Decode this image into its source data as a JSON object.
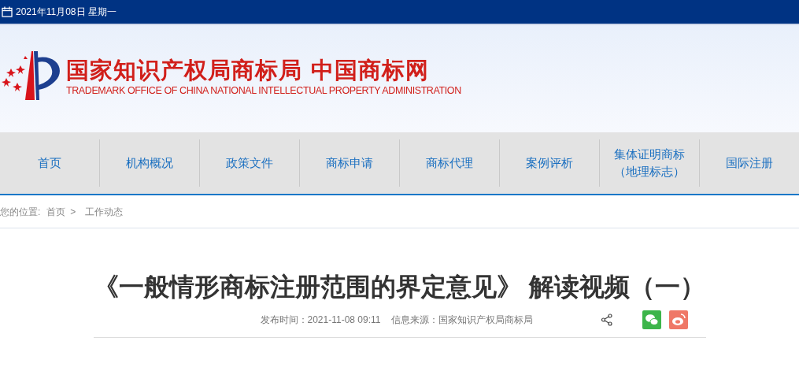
{
  "top_bar": {
    "date": "2021年11月08日 星期一"
  },
  "header": {
    "title": "国家知识产权局商标局 中国商标网",
    "subtitle": "TRADEMARK OFFICE OF CHINA NATIONAL INTELLECTUAL PROPERTY ADMINISTRATION"
  },
  "nav": {
    "items": [
      {
        "label": "首页"
      },
      {
        "label": "机构概况"
      },
      {
        "label": "政策文件"
      },
      {
        "label": "商标申请"
      },
      {
        "label": "商标代理"
      },
      {
        "label": "案例评析"
      },
      {
        "label": "集体证明商标（地理标志）"
      },
      {
        "label": "国际注册"
      }
    ]
  },
  "breadcrumb": {
    "prefix": "您的位置:",
    "items": [
      {
        "label": "首页"
      },
      {
        "label": "工作动态"
      }
    ],
    "separator": ">"
  },
  "article": {
    "title": "《一般情形商标注册范围的界定意见》 解读视频（一）",
    "published": "发布时间：2021-11-08 09:11",
    "source": "信息来源：国家知识产权局商标局"
  }
}
